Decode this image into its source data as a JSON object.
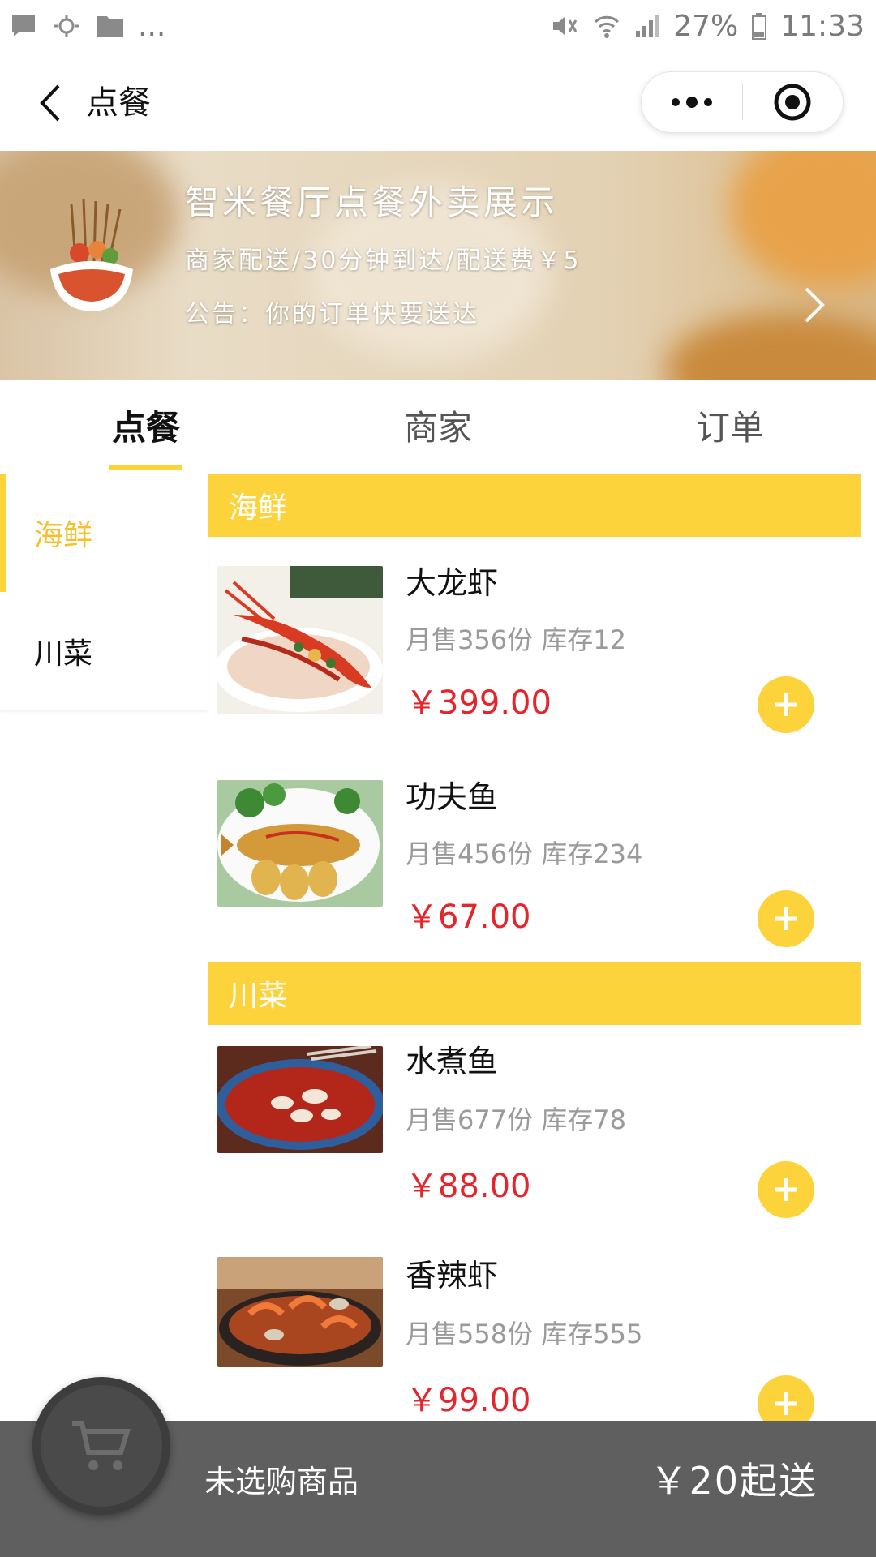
{
  "status_bar": {
    "left_icons": [
      "chat-icon",
      "weather-icon",
      "folder-icon"
    ],
    "more": "...",
    "battery": "27%",
    "time": "11:33"
  },
  "nav": {
    "title": "点餐",
    "back_icon": "chevron-left-icon",
    "more_icon": "more-dots-icon",
    "close_icon": "target-icon"
  },
  "banner": {
    "title": "智米餐厅点餐外卖展示",
    "subtitle": "商家配送/30分钟到达/配送费￥5",
    "notice": "公告：你的订单快要送达"
  },
  "tabs": [
    {
      "label": "点餐",
      "active": true
    },
    {
      "label": "商家",
      "active": false
    },
    {
      "label": "订单",
      "active": false
    }
  ],
  "sidebar": {
    "items": [
      {
        "label": "海鲜",
        "active": true
      },
      {
        "label": "川菜",
        "active": false
      }
    ]
  },
  "menu": {
    "categories": [
      {
        "name": "海鲜",
        "dishes": [
          {
            "name": "大龙虾",
            "meta": "月售356份 库存12",
            "price": "￥399.00"
          },
          {
            "name": "功夫鱼",
            "meta": "月售456份 库存234",
            "price": "￥67.00"
          }
        ]
      },
      {
        "name": "川菜",
        "dishes": [
          {
            "name": "水煮鱼",
            "meta": "月售677份 库存78",
            "price": "￥88.00"
          },
          {
            "name": "香辣虾",
            "meta": "月售558份 库存555",
            "price": "￥99.00"
          }
        ]
      }
    ]
  },
  "cart": {
    "icon": "cart-icon",
    "status": "未选购商品",
    "min_order": "￥20起送"
  },
  "colors": {
    "accent": "#fdd33c",
    "price": "#e5242b",
    "bottom_bar": "#5f5f5f",
    "active_side_text": "#f6c02a"
  }
}
